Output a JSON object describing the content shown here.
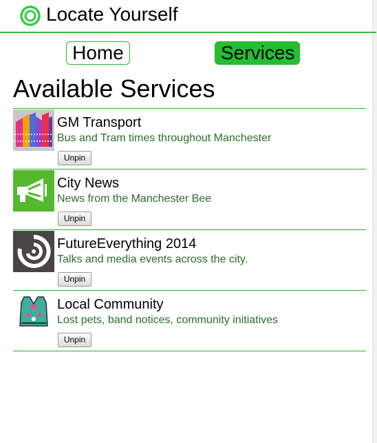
{
  "header": {
    "title": "Locate Yourself",
    "logo_icon": "ring-logo-icon",
    "accent": "#33bb33"
  },
  "nav": {
    "home_label": "Home",
    "services_label": "Services",
    "active": "Services",
    "active_color": "#25bd33"
  },
  "main": {
    "title": "Available Services",
    "services": [
      {
        "name": "GM Transport",
        "description": "Bus and Tram times throughout Manchester",
        "action_label": "Unpin",
        "icon": "gm-transport-thumbnail"
      },
      {
        "name": "City News",
        "description": "News from the Manchester Bee",
        "action_label": "Unpin",
        "icon": "megaphone-thumbnail"
      },
      {
        "name": "FutureEverything 2014",
        "description": "Talks and media events across the city.",
        "action_label": "Unpin",
        "icon": "futureeverything-logo-thumbnail"
      },
      {
        "name": "Local Community",
        "description": "Lost pets, band notices, community initiatives",
        "action_label": "Unpin",
        "icon": "knitted-vest-thumbnail"
      }
    ]
  }
}
